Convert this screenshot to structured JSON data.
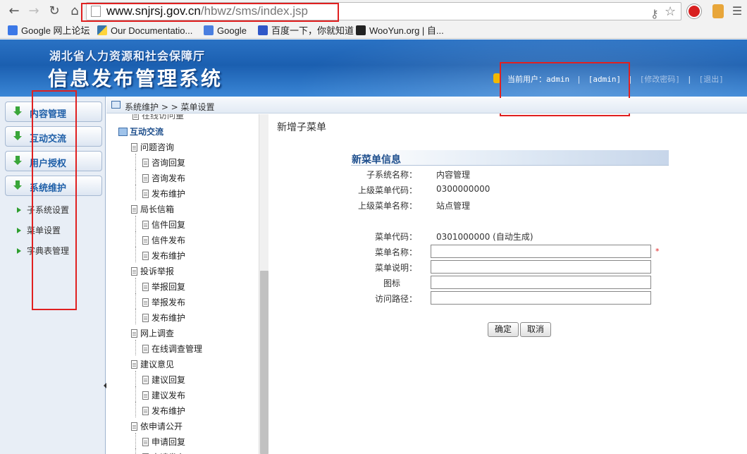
{
  "browser": {
    "url_host": "www.snjrsj.gov.cn",
    "url_path": "/hbwz/sms/index.jsp",
    "bookmarks": [
      "Google 网上论坛",
      "Our Documentatio...",
      "Google",
      "百度一下，你就知道",
      "WooYun.org | 自..."
    ]
  },
  "header": {
    "subtitle": "湖北省人力资源和社会保障厅",
    "title": "信息发布管理系统",
    "current_user_label": "当前用户：admin",
    "role": "[admin]",
    "change_password": "[修改密码]",
    "logout": "[退出]"
  },
  "sidebar": {
    "menus": [
      "内容管理",
      "互动交流",
      "用户授权",
      "系统维护"
    ],
    "subitems": [
      "子系统设置",
      "菜单设置",
      "字典表管理"
    ]
  },
  "breadcrumb": "系统维护 > > 菜单设置",
  "tree": {
    "partial_top": "在线访问量",
    "group": "互动交流",
    "items": [
      {
        "label": "问题咨询",
        "level": 1
      },
      {
        "label": "咨询回复",
        "level": 2
      },
      {
        "label": "咨询发布",
        "level": 2
      },
      {
        "label": "发布维护",
        "level": 2
      },
      {
        "label": "局长信箱",
        "level": 1
      },
      {
        "label": "信件回复",
        "level": 2
      },
      {
        "label": "信件发布",
        "level": 2
      },
      {
        "label": "发布维护",
        "level": 2
      },
      {
        "label": "投诉举报",
        "level": 1
      },
      {
        "label": "举报回复",
        "level": 2
      },
      {
        "label": "举报发布",
        "level": 2
      },
      {
        "label": "发布维护",
        "level": 2
      },
      {
        "label": "网上调查",
        "level": 1
      },
      {
        "label": "在线调查管理",
        "level": 2
      },
      {
        "label": "建议意见",
        "level": 1
      },
      {
        "label": "建议回复",
        "level": 2
      },
      {
        "label": "建议发布",
        "level": 2
      },
      {
        "label": "发布维护",
        "level": 2
      },
      {
        "label": "依申请公开",
        "level": 1
      },
      {
        "label": "申请回复",
        "level": 2
      },
      {
        "label": "申请发布",
        "level": 2
      }
    ]
  },
  "form": {
    "page_title": "新增子菜单",
    "section_title": "新菜单信息",
    "subsystem_label": "子系统名称：",
    "subsystem_value": "内容管理",
    "parent_code_label": "上级菜单代码：",
    "parent_code_value": "0300000000",
    "parent_name_label": "上级菜单名称：",
    "parent_name_value": "站点管理",
    "menu_code_label": "菜单代码：",
    "menu_code_value": "0301000000 (自动生成)",
    "menu_name_label": "菜单名称：",
    "menu_desc_label": "菜单说明：",
    "icon_label": "图标",
    "path_label": "访问路径：",
    "required_mark": "*",
    "confirm": "确定",
    "cancel": "取消"
  }
}
